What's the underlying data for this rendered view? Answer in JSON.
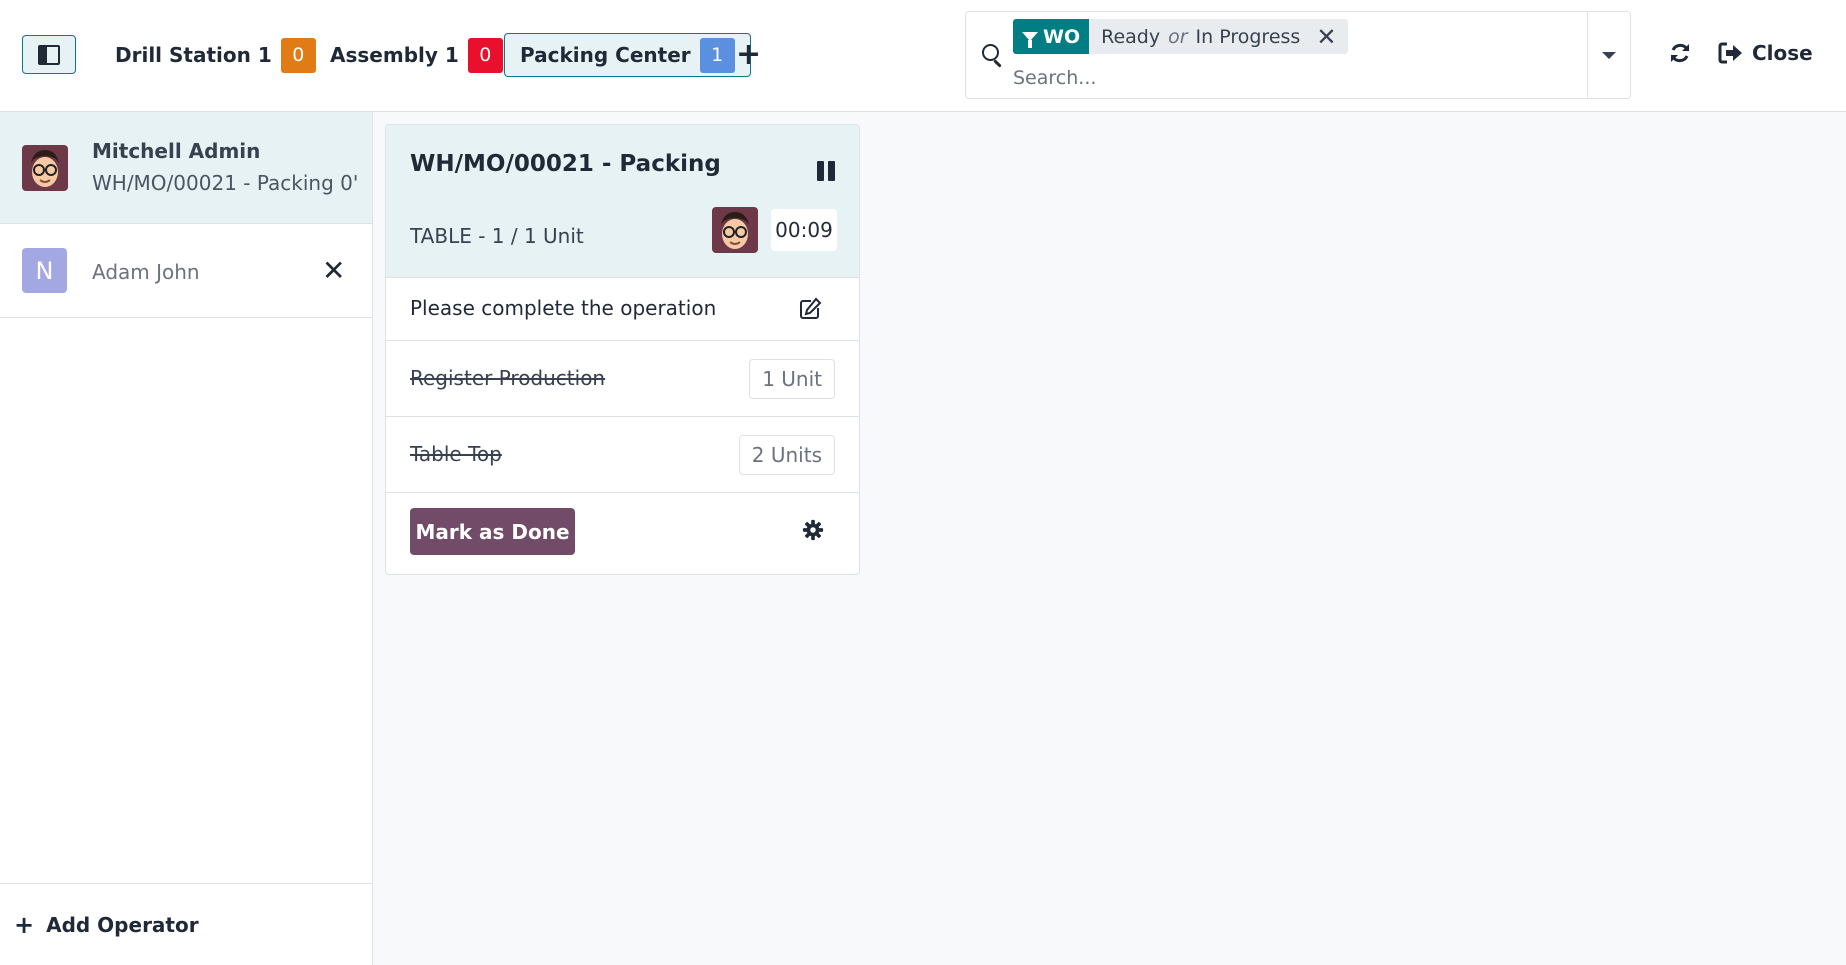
{
  "topbar": {
    "workcenters": [
      {
        "label": "Drill Station 1",
        "count": "0",
        "badge_color": "#e07b16"
      },
      {
        "label": "Assembly 1",
        "count": "0",
        "badge_color": "#e8102c"
      },
      {
        "label": "Packing Center",
        "count": "1",
        "badge_color": "#5b8fdf"
      }
    ],
    "add_icon": "plus-icon"
  },
  "search": {
    "facet_label": "WO",
    "facet_value_1": "Ready",
    "facet_or": "or",
    "facet_value_2": "In Progress",
    "placeholder": "Search..."
  },
  "actions": {
    "close_label": "Close"
  },
  "sidebar": {
    "employees": [
      {
        "name": "Mitchell Admin",
        "sub": "WH/MO/00021 - Packing 0'",
        "active": true
      },
      {
        "name": "Adam John",
        "initial": "N",
        "active": false
      }
    ],
    "add_operator_label": "Add Operator"
  },
  "workorder": {
    "title": "WH/MO/00021 - Packing",
    "product": "TABLE - 1 / 1 Unit",
    "timer": "00:09",
    "instruction": "Please complete the operation",
    "lines": [
      {
        "label": "Register Production",
        "qty": "1 Unit"
      },
      {
        "label": "Table Top",
        "qty": "2 Units"
      }
    ],
    "done_label": "Mark as Done"
  },
  "colors": {
    "accent": "#017e84",
    "primary": "#714b67"
  }
}
